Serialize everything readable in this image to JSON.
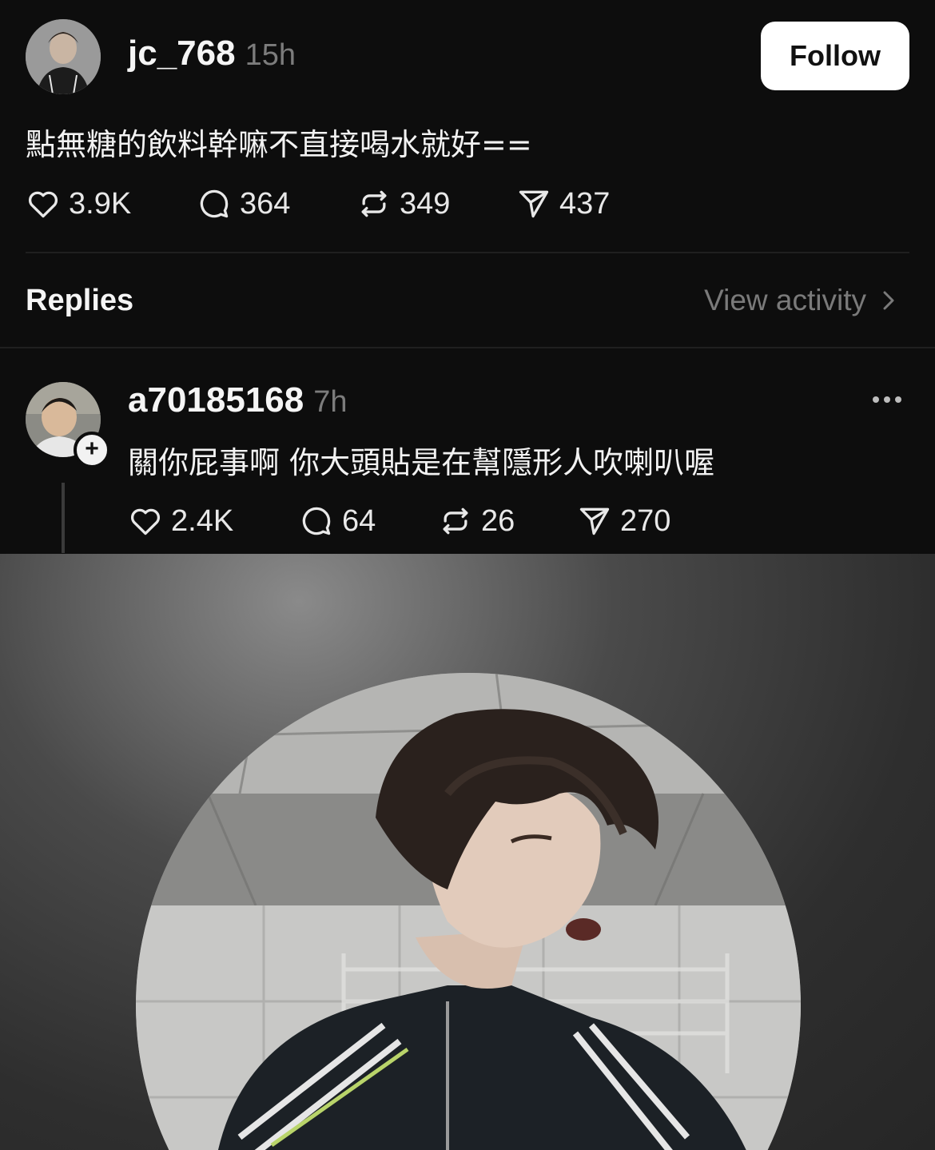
{
  "post": {
    "username": "jc_768",
    "time": "15h",
    "follow_label": "Follow",
    "text": "點無糖的飲料幹嘛不直接喝水就好==",
    "likes": "3.9K",
    "comments": "364",
    "reposts": "349",
    "shares": "437"
  },
  "replies_header": {
    "title": "Replies",
    "view_activity": "View activity"
  },
  "reply": {
    "username": "a70185168",
    "time": "7h",
    "text": "關你屁事啊 你大頭貼是在幫隱形人吹喇叭喔",
    "likes": "2.4K",
    "comments": "64",
    "reposts": "26",
    "shares": "270"
  },
  "icons": {
    "like": "heart-icon",
    "comment": "comment-bubble-icon",
    "repost": "repost-icon",
    "share": "send-icon",
    "more": "more-horizontal-icon",
    "chevron": "chevron-right-icon",
    "add": "plus-icon"
  },
  "colors": {
    "background": "#0d0d0d",
    "muted_text": "#7c7c7c",
    "follow_button": "#ffffff"
  }
}
